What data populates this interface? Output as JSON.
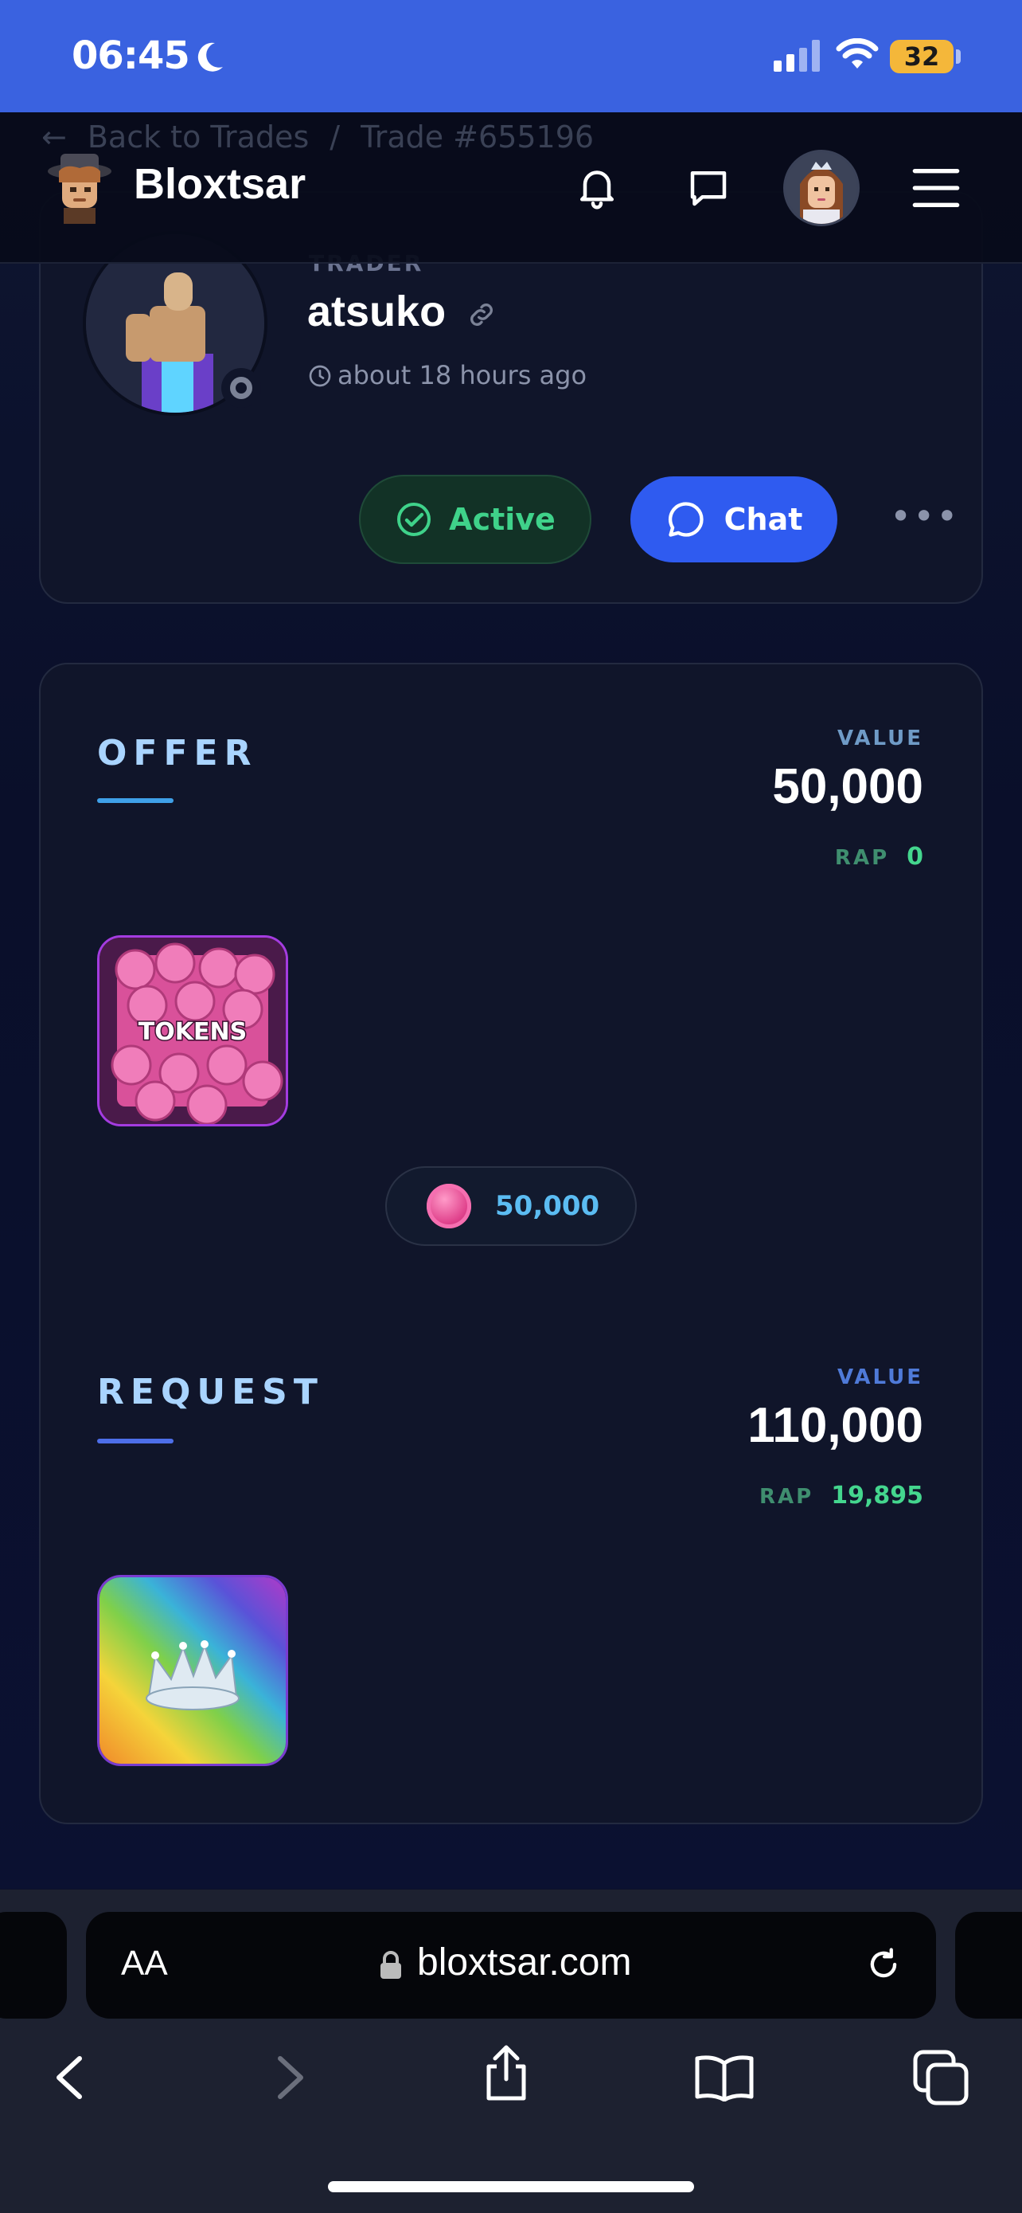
{
  "status_bar": {
    "time": "06:45",
    "battery": "32",
    "colors": {
      "background": "#3a62e0",
      "battery": "#f4b73a"
    }
  },
  "header": {
    "breadcrumb_back": "Back to Trades",
    "breadcrumb_separator": "/",
    "breadcrumb_current": "Trade #655196",
    "brand": "Bloxtsar",
    "icons": [
      "bell-icon",
      "chat-bubble-icon",
      "menu-icon"
    ]
  },
  "trader": {
    "label": "TRADER",
    "name": "atsuko",
    "time": "about 18 hours ago",
    "status_label": "Active",
    "chat_label": "Chat",
    "more_label": "•••"
  },
  "offer": {
    "title": "OFFER",
    "value_label": "VALUE",
    "value": "50,000",
    "rap_label": "RAP",
    "rap": "0",
    "item_label": "TOKENS",
    "tokens_amount": "50,000",
    "accent": "#3fa0e8"
  },
  "request": {
    "title": "REQUEST",
    "value_label": "VALUE",
    "value": "110,000",
    "rap_label": "RAP",
    "rap": "19,895",
    "accent": "#4d6ee8"
  },
  "browser": {
    "text_size_label": "AA",
    "url": "bloxtsar.com"
  }
}
